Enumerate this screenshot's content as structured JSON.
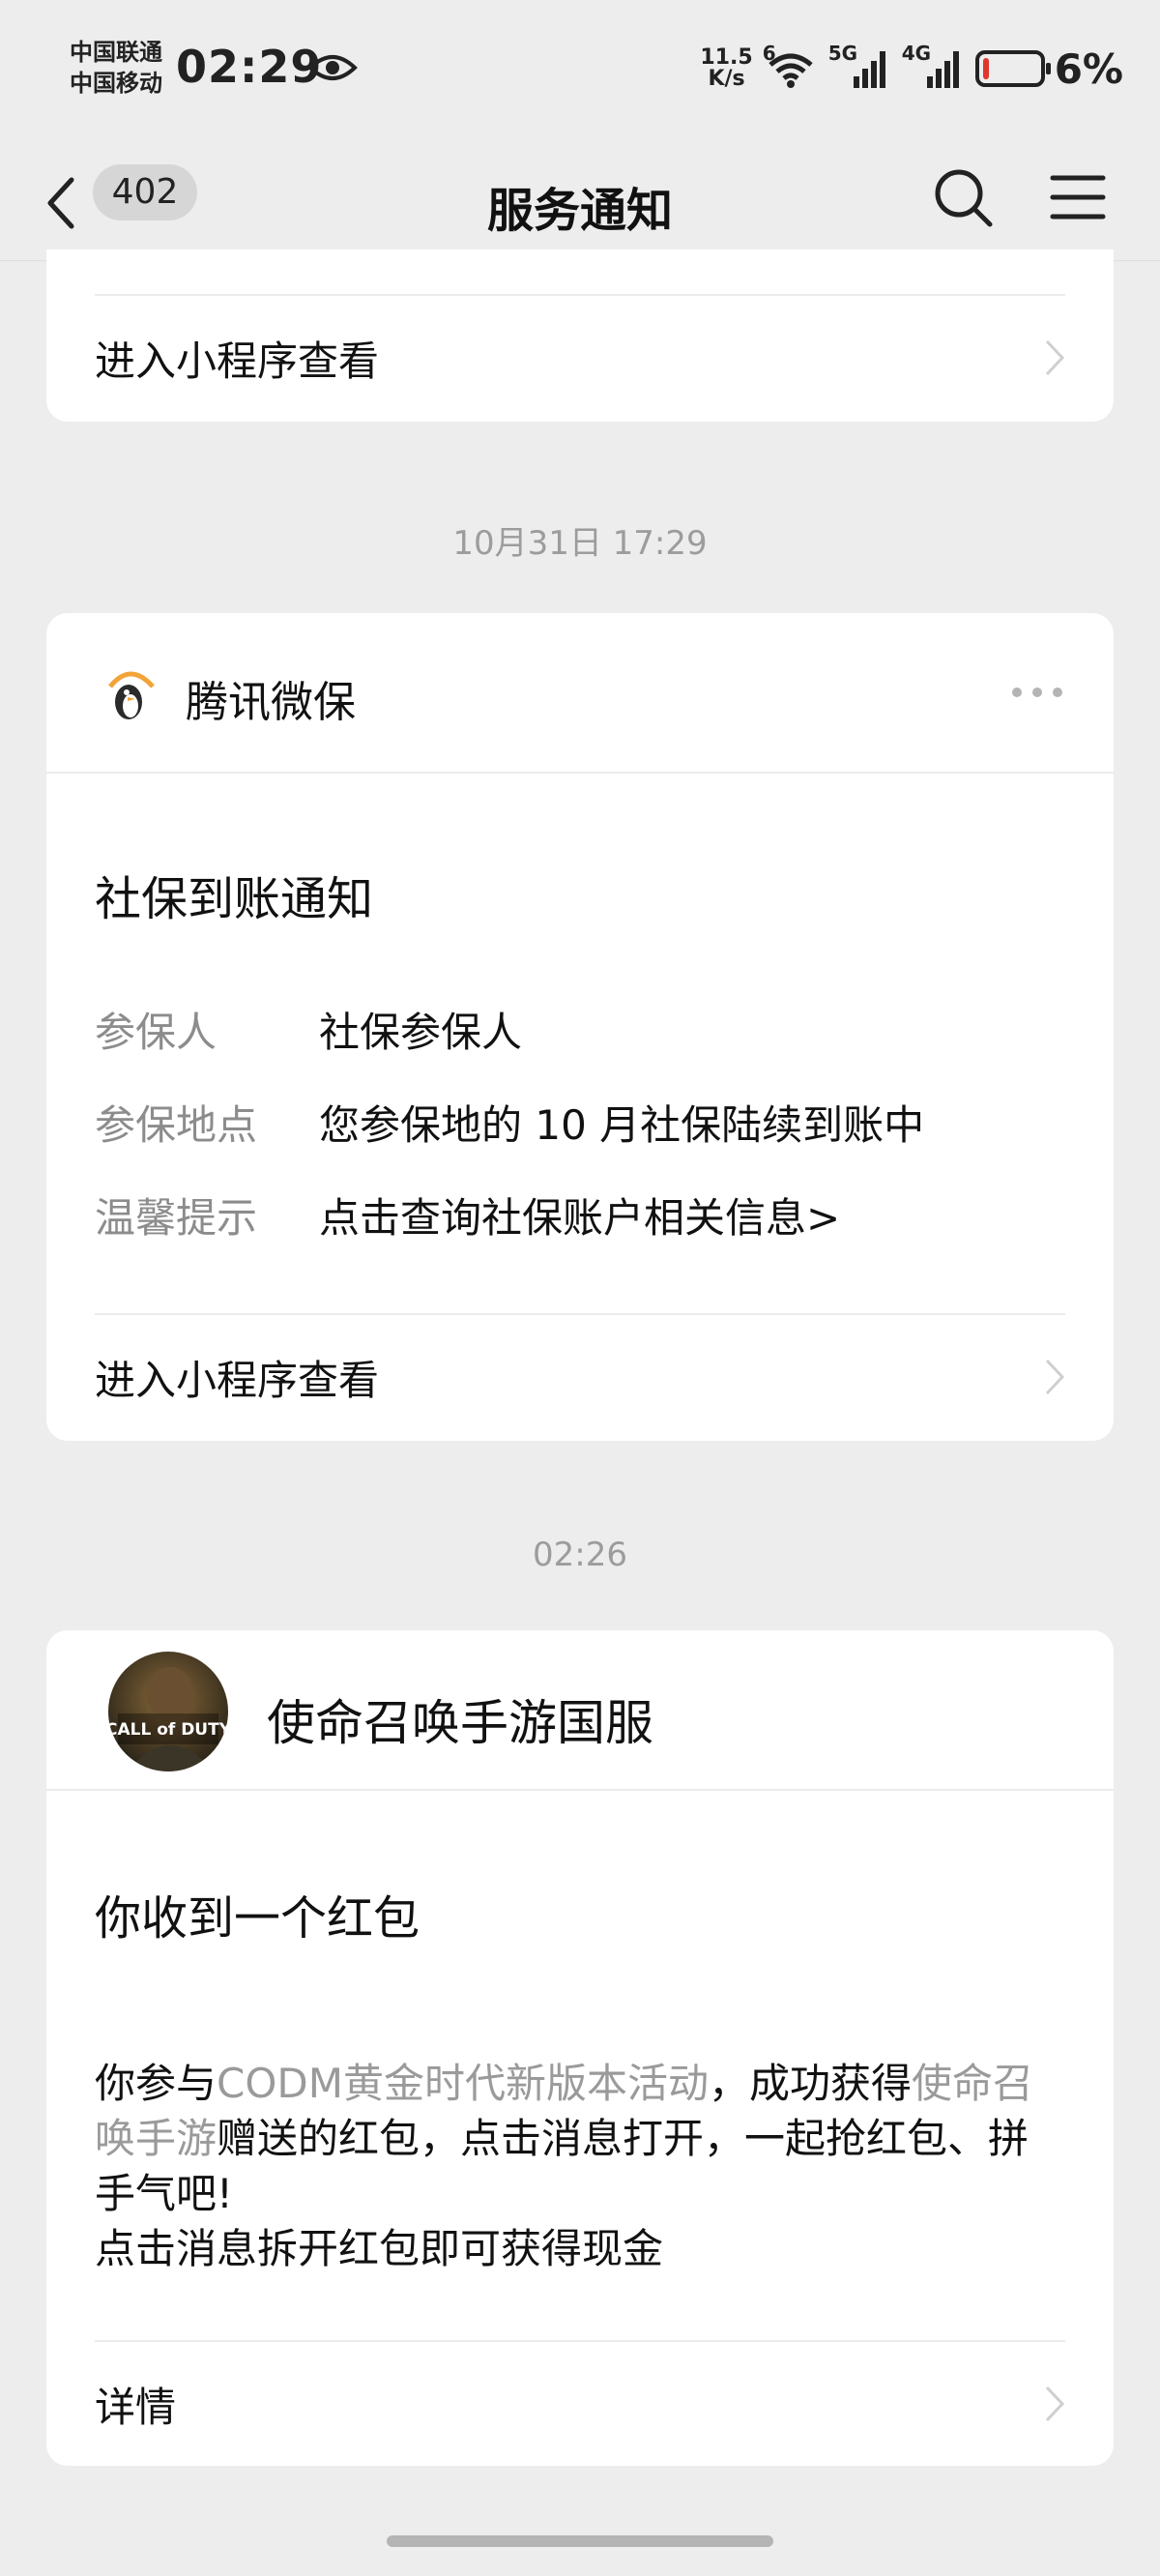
{
  "status_bar": {
    "carrier_1": "中国联通",
    "carrier_2": "中国移动",
    "time": "02:29",
    "net_speed_value": "11.5",
    "net_speed_unit": "K/s",
    "wifi_label": "6",
    "signal_1_label": "5G",
    "signal_2_label": "4G",
    "battery_percent_text": "6%",
    "battery_level": 0.06,
    "battery_color": "#e0362b",
    "icons": [
      "eye-icon",
      "wifi-icon",
      "signal-5g-icon",
      "signal-4g-icon",
      "battery-icon"
    ]
  },
  "nav": {
    "unread_count": "402",
    "title": "服务通知",
    "icons": [
      "back-arrow-icon",
      "search-icon",
      "menu-icon"
    ]
  },
  "card_top": {
    "link_label": "进入小程序查看"
  },
  "timestamps": {
    "first": "10月31日 17:29",
    "second": "02:26"
  },
  "card_insurance": {
    "brand_name": "腾讯微保",
    "brand_icon": "penguin-logo-icon",
    "title": "社保到账通知",
    "rows": [
      {
        "key": "参保人",
        "value": "社保参保人"
      },
      {
        "key": "参保地点",
        "value": "您参保地的 10 月社保陆续到账中"
      },
      {
        "key": "温馨提示",
        "value": "点击查询社保账户相关信息>"
      }
    ],
    "link_label": "进入小程序查看"
  },
  "card_game": {
    "brand_name": "使命召唤手游国服",
    "avatar_text": "CALL of DUTY",
    "title": "你收到一个红包",
    "body_parts": [
      "你参与",
      "CODM黄金时代新版本活动",
      "，成功获得",
      "使命召唤手游",
      "赠送的红包，点击消息打开，一起抢红包、拼手气吧!"
    ],
    "body_line2": "点击消息拆开红包即可获得现金",
    "link_label": "详情"
  },
  "colors": {
    "background": "#ededed",
    "card": "#ffffff",
    "muted_text": "#9a9a9a"
  }
}
